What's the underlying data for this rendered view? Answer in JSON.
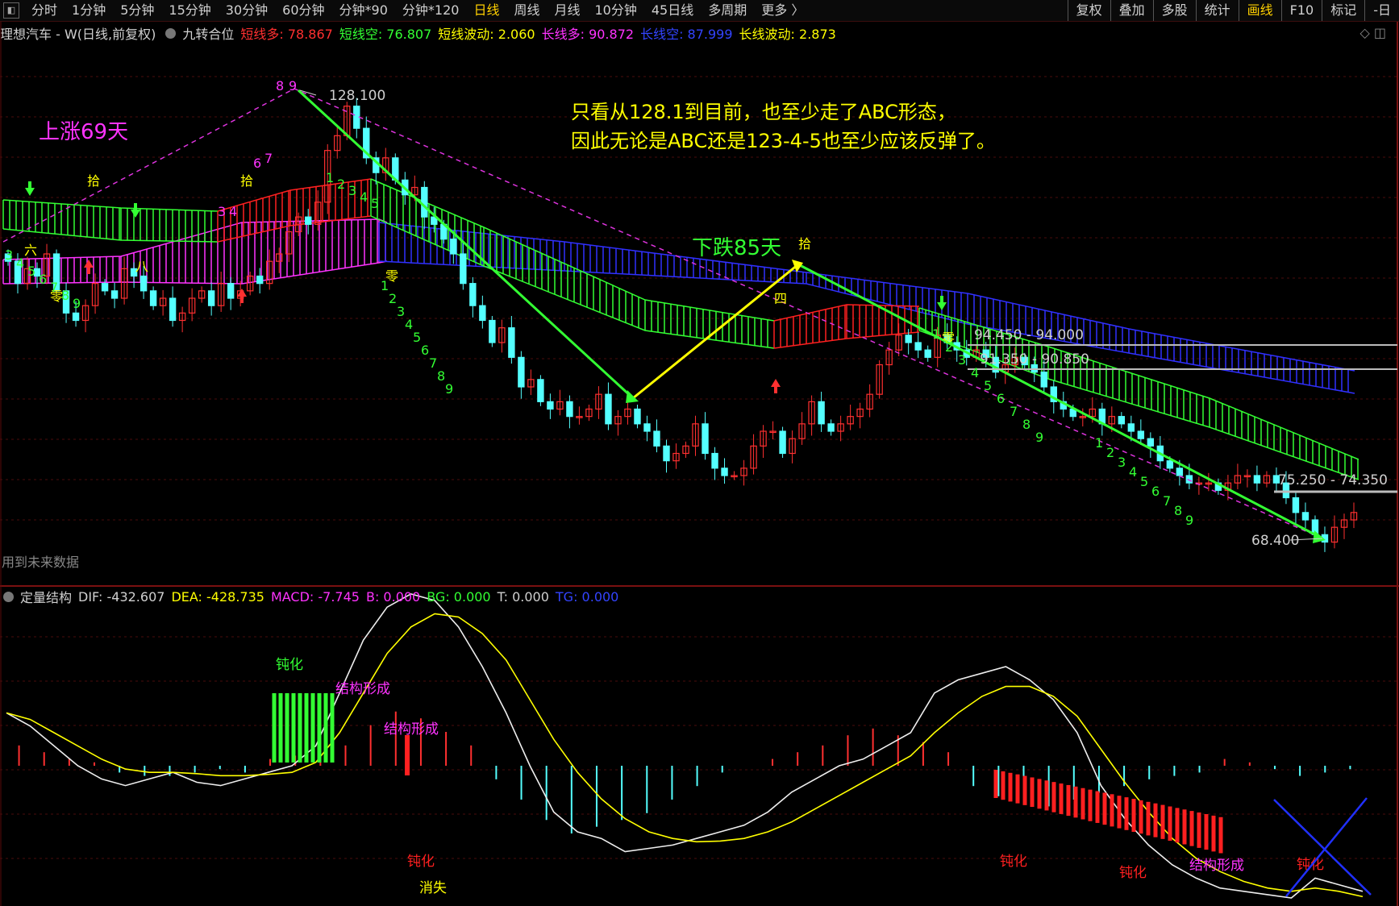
{
  "toolbar": {
    "periods": [
      "分时",
      "1分钟",
      "5分钟",
      "15分钟",
      "30分钟",
      "60分钟",
      "分钟*90",
      "分钟*120",
      "日线",
      "周线",
      "月线",
      "10分钟",
      "45日线",
      "多周期",
      "更多 〉"
    ],
    "active_period": "日线",
    "right_tools": [
      "复权",
      "叠加",
      "多股",
      "统计",
      "画线",
      "F10",
      "标记",
      "-日"
    ],
    "highlighted_tool": "画线"
  },
  "info": {
    "title": "理想汽车 - W(日线,前复权)",
    "indicator": "九转合位",
    "short_long_label": "短线多: 78.867",
    "short_short_label": "短线空: 76.807",
    "short_wave_label": "短线波动: 2.060",
    "long_long_label": "长线多: 90.872",
    "long_short_label": "长线空: 87.999",
    "long_wave_label": "长线波动: 2.873"
  },
  "macd_info": {
    "name": "定量结构",
    "dif": "DIF: -432.607",
    "dea": "DEA: -428.735",
    "macd": "MACD: -7.745",
    "b": "B: 0.000",
    "bg": "BG: 0.000",
    "t": "T: 0.000",
    "tg": "TG: 0.000"
  },
  "colors": {
    "bg": "#000000",
    "up": "#ff3030",
    "down": "#54ffff",
    "green_band": "#33ff33",
    "red_band": "#ff2020",
    "magenta_band": "#ff33ff",
    "blue_band": "#3030ff",
    "yellow": "#ffff00",
    "green_line": "#33ff33",
    "magenta_dash": "#dd33dd",
    "text_gray": "#d0d0d0",
    "grid": "#4a0c0c"
  },
  "annotations": {
    "note_line1": "只看从128.1到目前，也至少走了ABC形态，",
    "note_line2": "因此无论是ABC还是123-4-5也至少应该反弹了。",
    "rise_label": "上涨69天",
    "fall_label": "下跌85天",
    "high_label": "128.100",
    "low_label": "68.400",
    "level_1": "94.450 - 94.000",
    "level_2": "91.350 - 90.850",
    "level_3": "75.250 - 74.350",
    "future_note": "用到未来数据",
    "shi_1": "拾",
    "shi_2": "拾",
    "shi_3": "拾",
    "si": "四",
    "ling_1": "零",
    "ling_2": "零",
    "ling_3": "零",
    "ling_4": "零",
    "ba": "八",
    "liu": "六",
    "macd_dunhua_1": "钝化",
    "macd_jiegou_1": "结构形成",
    "macd_jiegou_2": "结构形成",
    "macd_dunhua_2": "钝化",
    "macd_xiaoshi": "消失",
    "macd_dunhua_3": "钝化",
    "macd_dunhua_4": "钝化",
    "macd_jiegou_3": "结构形成",
    "macd_dunhua_5": "钝化"
  },
  "nine_counts": {
    "set1": [
      "3",
      "4",
      "5",
      "6",
      "7",
      "8",
      "9"
    ],
    "set2": [
      "8",
      "9"
    ],
    "set3": [
      "6",
      "7"
    ],
    "set4": [
      "1",
      "2",
      "3",
      "4",
      "5"
    ],
    "set5": [
      "3",
      "4"
    ],
    "set6": [
      "1",
      "2",
      "3",
      "4",
      "5",
      "6",
      "7",
      "8",
      "9"
    ],
    "set7": [
      "1",
      "2",
      "3",
      "4",
      "5",
      "6",
      "7",
      "8",
      "9"
    ],
    "set8": [
      "1",
      "2",
      "3",
      "4",
      "5",
      "6",
      "7",
      "8",
      "9"
    ]
  },
  "chart_data": {
    "type": "candlestick",
    "title": "理想汽车 - W(日线,前复权)",
    "period": "日线",
    "price_range": [
      66,
      132
    ],
    "marked_high": 128.1,
    "marked_low": 68.4,
    "support_resistance": [
      [
        94.45,
        94.0
      ],
      [
        91.35,
        90.85
      ],
      [
        75.25,
        74.35
      ]
    ],
    "series_close": [
      107,
      104,
      106,
      105,
      108,
      103,
      100,
      99,
      101,
      104,
      103,
      102,
      106,
      105,
      103,
      101,
      102,
      99,
      100,
      102,
      103,
      101,
      104,
      102,
      103,
      105,
      104,
      107,
      108,
      111,
      113,
      112,
      115,
      122,
      124,
      128,
      125,
      121,
      119,
      121,
      118,
      116,
      117,
      113,
      112,
      110,
      108,
      104,
      101,
      99,
      96,
      98,
      94,
      90,
      91,
      88,
      87,
      88,
      86,
      86,
      87,
      89,
      85,
      86,
      87,
      85,
      84,
      82,
      80,
      81,
      82,
      85,
      81,
      79,
      78,
      78,
      79,
      82,
      84,
      84,
      81,
      83,
      85,
      88,
      85,
      84,
      85,
      86,
      87,
      89,
      93,
      95,
      97,
      96,
      95,
      94,
      97,
      96,
      95,
      94,
      95,
      94,
      92,
      93,
      94,
      93,
      92,
      90,
      88,
      87,
      86,
      86,
      87,
      85,
      86,
      85,
      84,
      83,
      82,
      80,
      79,
      78,
      77,
      77,
      77,
      76,
      77,
      78,
      78,
      77,
      78,
      77,
      75,
      73,
      72,
      70,
      69,
      71,
      72,
      73
    ],
    "dif_series": [
      -150,
      -170,
      -200,
      -230,
      -250,
      -260,
      -250,
      -240,
      -255,
      -260,
      -250,
      -240,
      -230,
      -200,
      -120,
      -40,
      10,
      30,
      20,
      -20,
      -80,
      -150,
      -230,
      -300,
      -330,
      -340,
      -360,
      -355,
      -350,
      -340,
      -330,
      -320,
      -300,
      -270,
      -250,
      -230,
      -220,
      -200,
      -180,
      -120,
      -100,
      -90,
      -80,
      -100,
      -130,
      -180,
      -260,
      -310,
      -350,
      -380,
      -400,
      -415,
      -420,
      -425,
      -430,
      -400,
      -410,
      -420
    ],
    "dea_series": [
      -150,
      -160,
      -180,
      -200,
      -220,
      -235,
      -240,
      -240,
      -242,
      -245,
      -245,
      -243,
      -240,
      -225,
      -180,
      -120,
      -60,
      -20,
      0,
      -5,
      -30,
      -70,
      -130,
      -190,
      -240,
      -280,
      -310,
      -330,
      -340,
      -345,
      -344,
      -340,
      -330,
      -315,
      -295,
      -275,
      -255,
      -235,
      -215,
      -180,
      -150,
      -125,
      -110,
      -110,
      -125,
      -155,
      -205,
      -255,
      -300,
      -340,
      -370,
      -390,
      -405,
      -415,
      -420,
      -415,
      -420,
      -428
    ],
    "macd_hist": [
      60,
      40,
      20,
      10,
      -20,
      -30,
      -30,
      -20,
      -10,
      -20,
      20,
      30,
      40,
      60,
      120,
      160,
      140,
      100,
      60,
      -40,
      -100,
      -160,
      -200,
      -180,
      -160,
      -140,
      -100,
      -60,
      -20,
      0,
      20,
      40,
      60,
      90,
      110,
      90,
      70,
      40,
      -60,
      -90,
      -110,
      -120,
      -100,
      -80,
      -60,
      -40,
      -30,
      -20,
      20,
      10,
      -10,
      -30,
      -20,
      -10
    ]
  }
}
